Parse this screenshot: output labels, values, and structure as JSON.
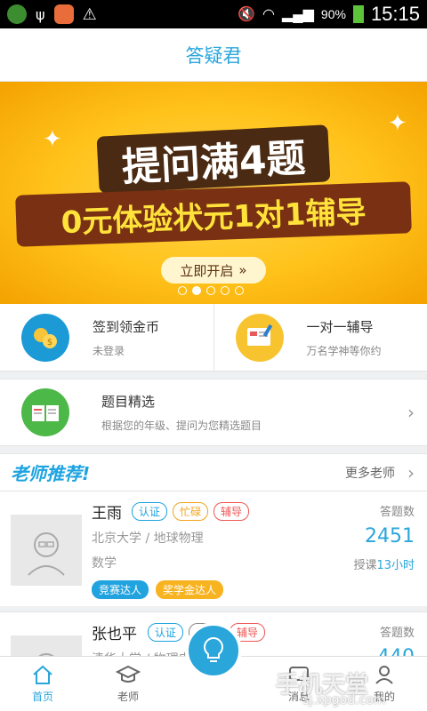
{
  "status_bar": {
    "battery": "90%",
    "time": "15:15"
  },
  "header": {
    "title": "答疑君"
  },
  "banner": {
    "line1": "提问满4题",
    "line2": "0元体验状元1对1辅导",
    "button_label": "立即开启",
    "button_arrow": "»",
    "pages": 5,
    "active_page": 2
  },
  "quick_actions": [
    {
      "title": "签到领金币",
      "subtitle": "未登录",
      "icon": "coins-icon"
    },
    {
      "title": "一对一辅导",
      "subtitle": "万名学神等你约",
      "icon": "tutoring-icon"
    }
  ],
  "featured": {
    "title": "题目精选",
    "subtitle": "根据您的年级、提问为您精选题目",
    "icon": "book-icon"
  },
  "teachers_section": {
    "title": "老师推荐!",
    "more_label": "更多老师"
  },
  "teachers": [
    {
      "name": "王雨",
      "tags": [
        "认证",
        "忙碌",
        "辅导"
      ],
      "school": "北京大学 / 地球物理",
      "subject": "数学",
      "badges": [
        "竞赛达人",
        "奖学金达人"
      ],
      "answer_label": "答题数",
      "answer_count": "2451",
      "tutor_time_label": "授课",
      "tutor_time_value": "13小时"
    },
    {
      "name": "张也平",
      "tags": [
        "认证",
        "离线",
        "辅导"
      ],
      "school": "清华大学 / 物理电子学",
      "answer_label": "答题数",
      "answer_count": "440"
    }
  ],
  "tabbar": {
    "items": [
      "首页",
      "老师",
      "消息",
      "我的"
    ]
  },
  "watermark": {
    "title": "手机天堂",
    "url": "sj.xpgod.com"
  }
}
